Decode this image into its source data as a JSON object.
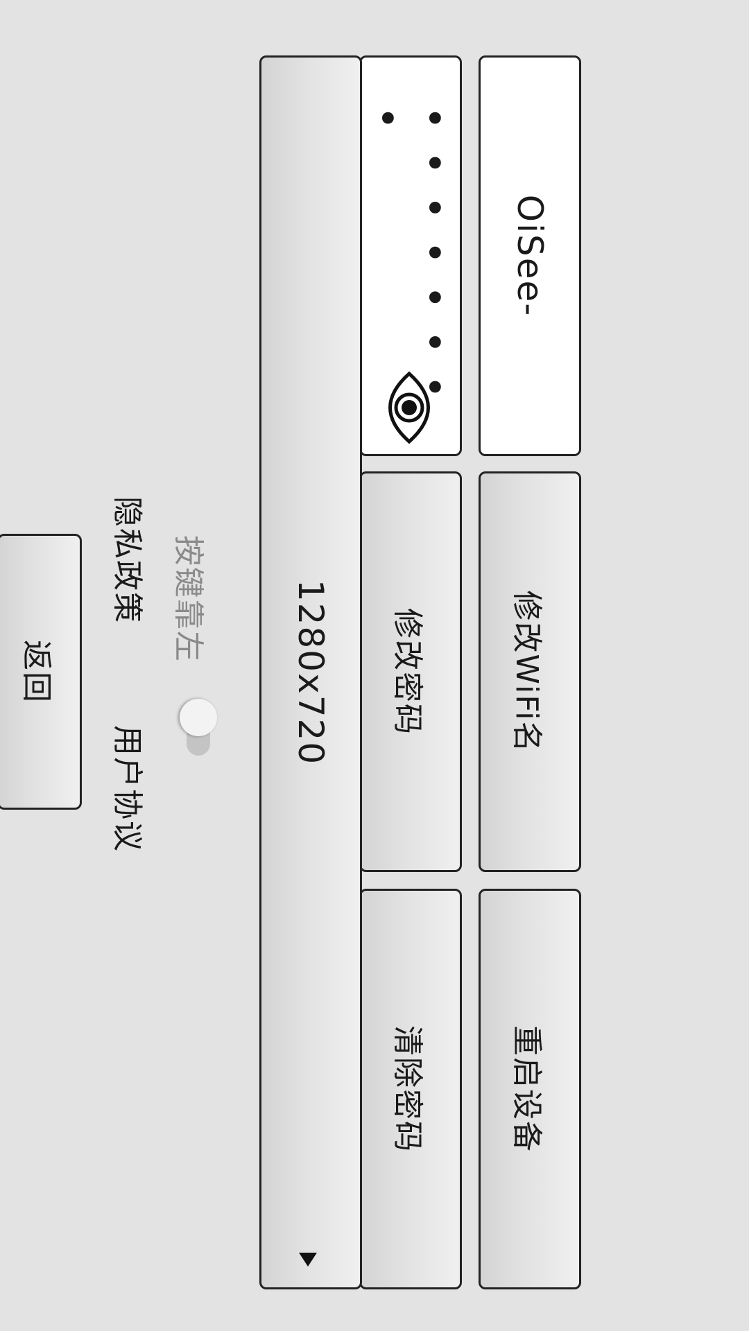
{
  "wifi": {
    "ssid": "OiSee-",
    "password_masked": "• • • • • • • •",
    "change_name_label": "修改WiFi名",
    "restart_label": "重启设备"
  },
  "password": {
    "change_label": "修改密码",
    "clear_label": "清除密码",
    "visibility_icon": "eye-icon"
  },
  "resolution": {
    "selected": "1280x720"
  },
  "settings": {
    "keys_left_label": "按键靠左",
    "keys_left_on": false
  },
  "links": {
    "privacy_label": "隐私政策",
    "agreement_label": "用户协议"
  },
  "back_label": "返回"
}
